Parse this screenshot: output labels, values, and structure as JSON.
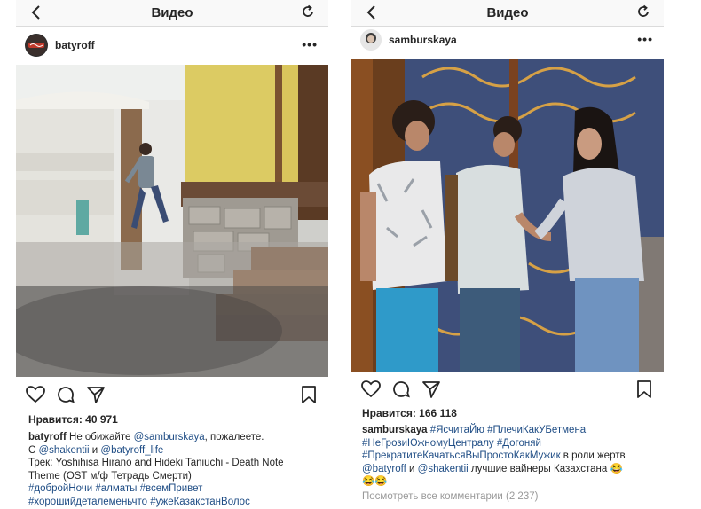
{
  "left": {
    "topbar": {
      "title": "Видео"
    },
    "header": {
      "username": "batyroff",
      "more": "•••"
    },
    "likes": "Нравится: 40 971",
    "caption": {
      "user": "batyroff",
      "l1_text": " Не обижайте ",
      "l1_mention": "@samburskaya",
      "l1_tail": ", пожалеете.",
      "l2_pre": "С ",
      "l2_m1": "@shakentii",
      "l2_mid": " и ",
      "l2_m2": "@batyroff_life",
      "l3": "Трек: Yoshihisa Hirano and Hideki Taniuchi - Death Note",
      "l4": "Theme (OST м/ф Тетрадь Смерти)",
      "l5": "#добройНочи #алматы #всемПривет",
      "l6": "#хорошийдеталеменьчто #ужеКазакстанВолос"
    }
  },
  "right": {
    "topbar": {
      "title": "Видео"
    },
    "header": {
      "username": "samburskaya",
      "more": "•••"
    },
    "likes": "Нравится: 166 118",
    "caption": {
      "user": "samburskaya",
      "l1_tags": " #ЯсчитаЙю #ПлечиКакУБетмена",
      "l2_tags": "#НеГрозиЮжномуЦентралу #Догоняй",
      "l3_tags": "#ПрекратитеКачатьсяВыПростоКакМужик",
      "l3_tail": " в роли жертв",
      "l4_m1": "@batyroff",
      "l4_mid": " и ",
      "l4_m2": "@shakentii",
      "l4_tail": " лучшие вайнеры Казахстана 😂",
      "l5": "😂😂",
      "view_all": "Посмотреть все комментарии (2 237)"
    }
  },
  "colors": {
    "link": "#1f4d85",
    "muted": "#999999",
    "text": "#262626",
    "bar": "#f9f9f9"
  }
}
